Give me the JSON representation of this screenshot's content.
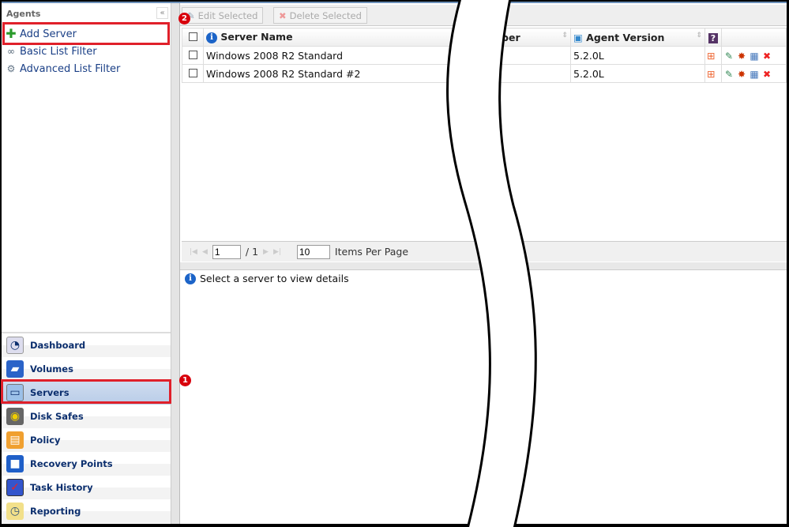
{
  "sidebar": {
    "title": "Agents",
    "collapse_icon": "«",
    "links": [
      {
        "label": "Add Server",
        "icon": "plus-icon"
      },
      {
        "label": "Basic List Filter",
        "icon": "binoculars-icon"
      },
      {
        "label": "Advanced List Filter",
        "icon": "gears-icon"
      }
    ],
    "nav": [
      {
        "label": "Dashboard",
        "icon": "dashboard-icon"
      },
      {
        "label": "Volumes",
        "icon": "book-icon"
      },
      {
        "label": "Servers",
        "icon": "monitor-icon",
        "selected": true
      },
      {
        "label": "Disk Safes",
        "icon": "safe-icon"
      },
      {
        "label": "Policy",
        "icon": "clipboard-icon"
      },
      {
        "label": "Recovery Points",
        "icon": "cubes-icon"
      },
      {
        "label": "Task History",
        "icon": "checklist-icon"
      },
      {
        "label": "Reporting",
        "icon": "clock-notes-icon"
      }
    ]
  },
  "toolbar": {
    "edit": "Edit Selected",
    "delete": "Delete Selected"
  },
  "table": {
    "columns": [
      "Server Name",
      "mber",
      "Agent Version",
      "?"
    ],
    "rows": [
      {
        "name": "Windows 2008 R2 Standard",
        "version": "5.2.0L"
      },
      {
        "name": "Windows 2008 R2 Standard #2",
        "version": "5.2.0L"
      }
    ]
  },
  "pager": {
    "page": "1",
    "of": "/ 1",
    "per_page": "10",
    "per_page_label": "Items Per Page"
  },
  "details": {
    "message": "Select a server to view details"
  },
  "annotations": {
    "badge1": "1",
    "badge2": "2",
    "color": "#e0202a"
  }
}
